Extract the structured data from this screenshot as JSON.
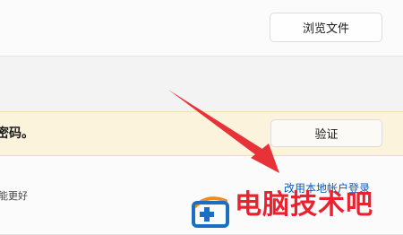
{
  "browse": {
    "button_label": "浏览文件"
  },
  "verify": {
    "message": "密码。",
    "button_label": "验证"
  },
  "local_account": {
    "link_text": "改用本地帐户登录",
    "note": "能更好"
  },
  "watermark": {
    "text": "电脑技术吧",
    "color": "#ea2230"
  },
  "colors": {
    "arrow": "#e8323a",
    "link": "#0a5bbd",
    "warning_bg": "#fcf3dc"
  }
}
